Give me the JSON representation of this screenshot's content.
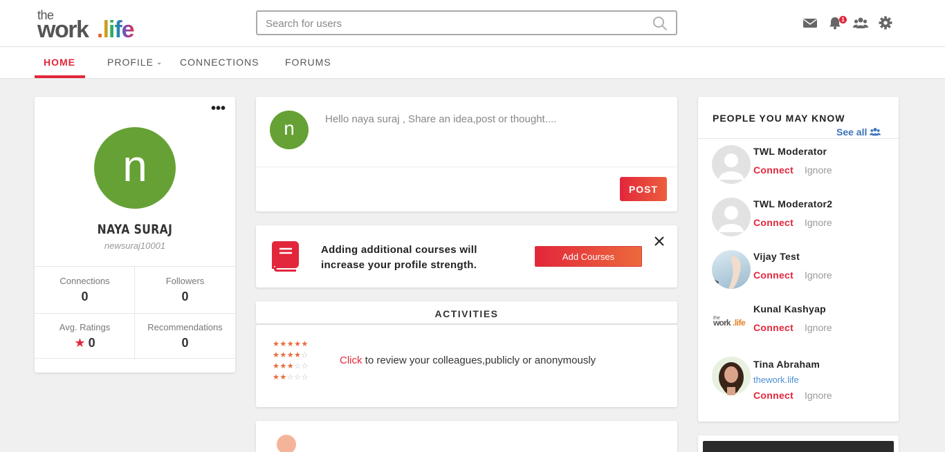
{
  "logo": {
    "the": "the",
    "work": "work",
    "life": ".life"
  },
  "search": {
    "placeholder": "Search for users"
  },
  "header": {
    "notification_count": "1"
  },
  "nav": {
    "home": "HOME",
    "profile": "PROFILE",
    "connections": "CONNECTIONS",
    "forums": "FORUMS"
  },
  "profile": {
    "more": "•••",
    "initial": "n",
    "name": "NAYA SURAJ",
    "username": "newsuraj10001",
    "stats": [
      {
        "label": "Connections",
        "value": "0"
      },
      {
        "label": "Followers",
        "value": "0"
      },
      {
        "label": "Avg. Ratings",
        "value": "0"
      },
      {
        "label": "Recommendations",
        "value": "0"
      }
    ]
  },
  "post": {
    "initial": "n",
    "prompt": "Hello naya suraj , Share an idea,post or thought....",
    "button": "POST"
  },
  "courses": {
    "text": "Adding additional courses will increase your profile strength.",
    "button": "Add Courses"
  },
  "activities": {
    "title": "ACTIVITIES",
    "click": "Click",
    "text": " to review your colleagues,publicly or anonymously",
    "star_rows": [
      5,
      4,
      3,
      2
    ]
  },
  "people": {
    "title": "PEOPLE YOU MAY KNOW",
    "see_all": "See all",
    "connect": "Connect",
    "ignore": "Ignore",
    "list": [
      {
        "name": "TWL Moderator",
        "sub": ""
      },
      {
        "name": "TWL Moderator2",
        "sub": ""
      },
      {
        "name": "Vijay Test",
        "sub": ""
      },
      {
        "name": "Kunal Kashyap",
        "sub": ""
      },
      {
        "name": "Tina Abraham",
        "sub": "thework.life"
      }
    ]
  },
  "colors": {
    "accent": "#e2263b",
    "avatar_green": "#66a135",
    "link_blue": "#3b73b9"
  }
}
